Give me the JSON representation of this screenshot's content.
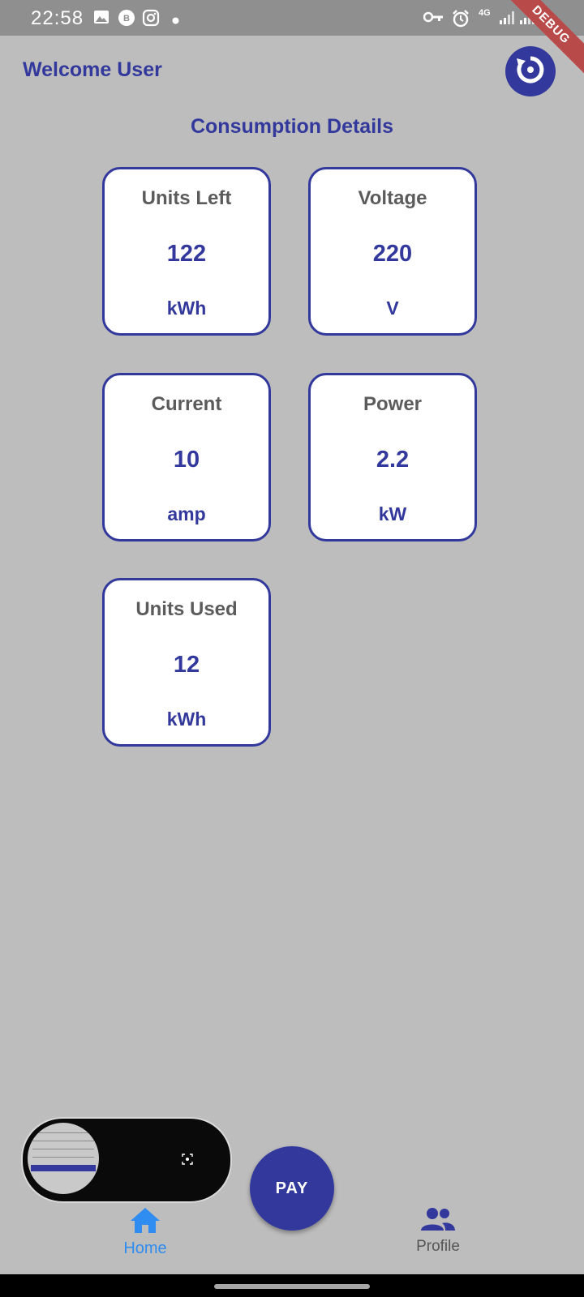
{
  "status_bar": {
    "time": "22:58",
    "left_icons": [
      "image-icon",
      "whatsapp-business-icon",
      "instagram-icon",
      "dot-icon"
    ],
    "right_icons": [
      "vpn-key-icon",
      "alarm-icon",
      "4g-icon",
      "signal-icon",
      "signal-icon",
      "battery-icon"
    ],
    "network_label": "4G"
  },
  "debug_banner": "DEBUG",
  "header": {
    "welcome_text": "Welcome User",
    "refresh_icon": "refresh-icon"
  },
  "section_title": "Consumption Details",
  "cards": [
    {
      "label": "Units Left",
      "value": "122",
      "unit": "kWh"
    },
    {
      "label": "Voltage",
      "value": "220",
      "unit": "V"
    },
    {
      "label": "Current",
      "value": "10",
      "unit": "amp"
    },
    {
      "label": "Power",
      "value": "2.2",
      "unit": "kW"
    },
    {
      "label": "Units Used",
      "value": "12",
      "unit": "kWh"
    }
  ],
  "overlay": {
    "icon": "screenshot-focus-icon"
  },
  "pay_button": "PAY",
  "bottom_nav": {
    "items": [
      {
        "label": "Home",
        "icon": "home-icon",
        "active": true
      },
      {
        "label": "Profile",
        "icon": "people-icon",
        "active": false
      }
    ],
    "active_color": "#2f8cf0"
  },
  "colors": {
    "accent": "#33399c",
    "background": "#bdbdbd",
    "card_background": "#ffffff"
  }
}
